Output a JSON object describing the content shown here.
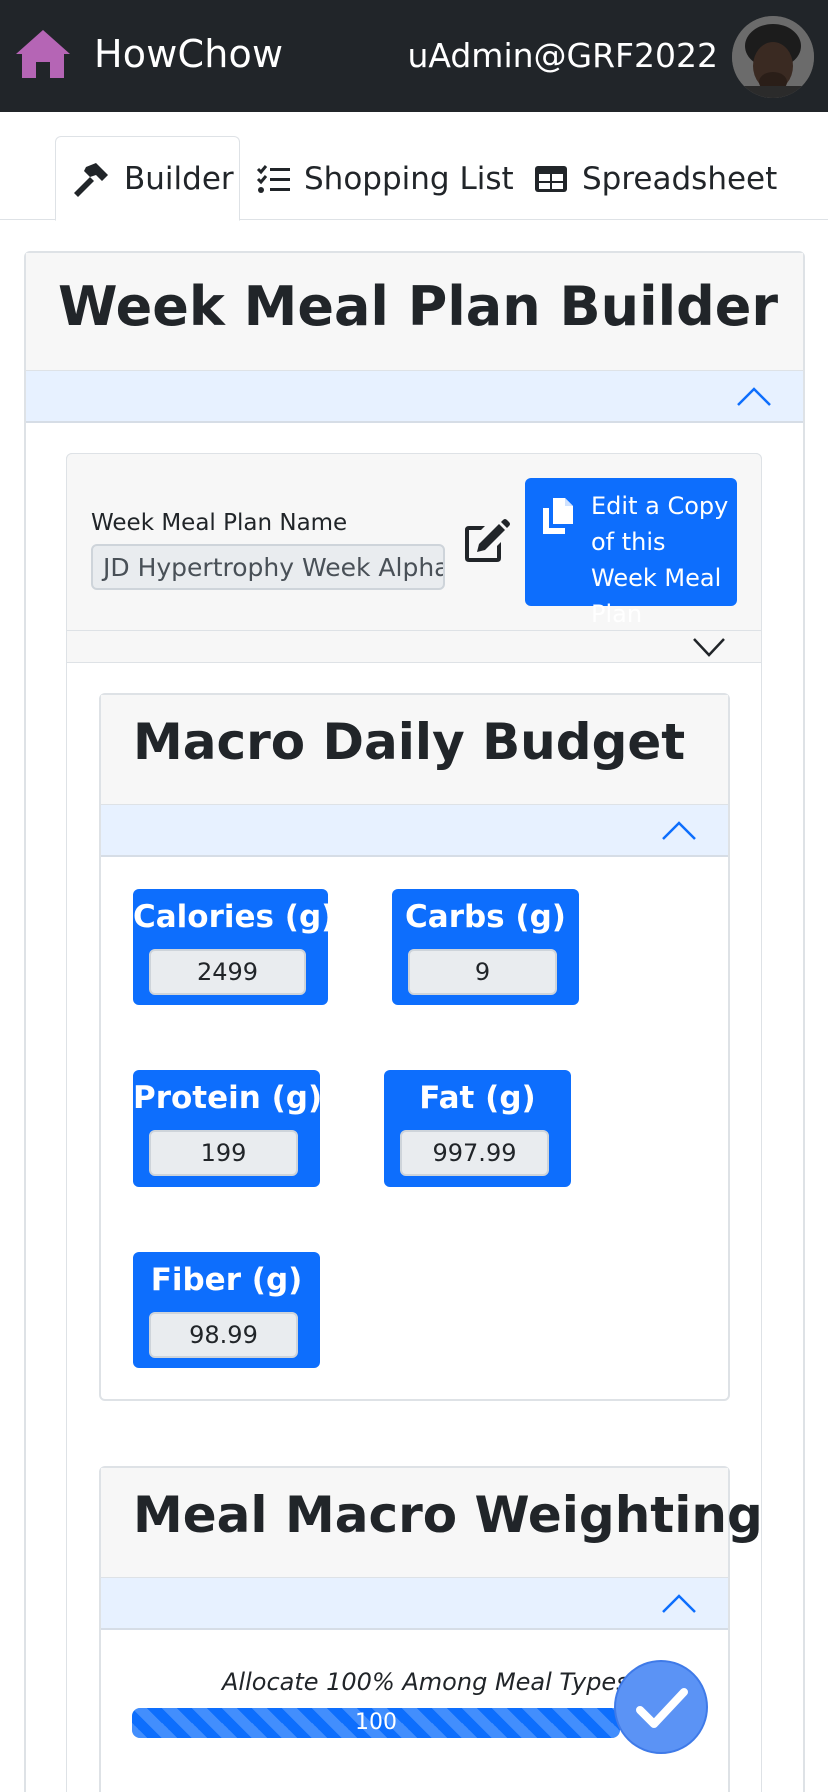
{
  "navbar": {
    "brand": "HowChow",
    "user": "uAdmin@GRF2022",
    "home_icon": "home-icon",
    "home_icon_color": "#b565b5"
  },
  "tabs": [
    {
      "label": "Builder",
      "icon": "hammer-icon",
      "active": true
    },
    {
      "label": "Shopping List",
      "icon": "checklist-icon",
      "active": false
    },
    {
      "label": "Spreadsheet",
      "icon": "table-icon",
      "active": false
    }
  ],
  "builder": {
    "title": "Week Meal Plan Builder"
  },
  "plan": {
    "name_label": "Week Meal Plan Name",
    "name_value": "JD Hypertrophy Week Alpha F",
    "copy_button": "Edit a Copy of this Week Meal Plan"
  },
  "macro_budget": {
    "title": "Macro Daily Budget",
    "tiles": [
      {
        "label": "Calories (g)",
        "value": "2499"
      },
      {
        "label": "Carbs (g)",
        "value": "9"
      },
      {
        "label": "Protein (g)",
        "value": "199"
      },
      {
        "label": "Fat (g)",
        "value": "997.99"
      },
      {
        "label": "Fiber (g)",
        "value": "98.99"
      }
    ]
  },
  "weighting": {
    "title": "Meal Macro Weighting",
    "allocate_label": "Allocate 100% Among Meal Types",
    "progress_value": "100",
    "progress_percent": 100
  },
  "colors": {
    "primary": "#0d6efd",
    "navbar": "#212529",
    "collapse_bar": "#e7f1ff"
  }
}
